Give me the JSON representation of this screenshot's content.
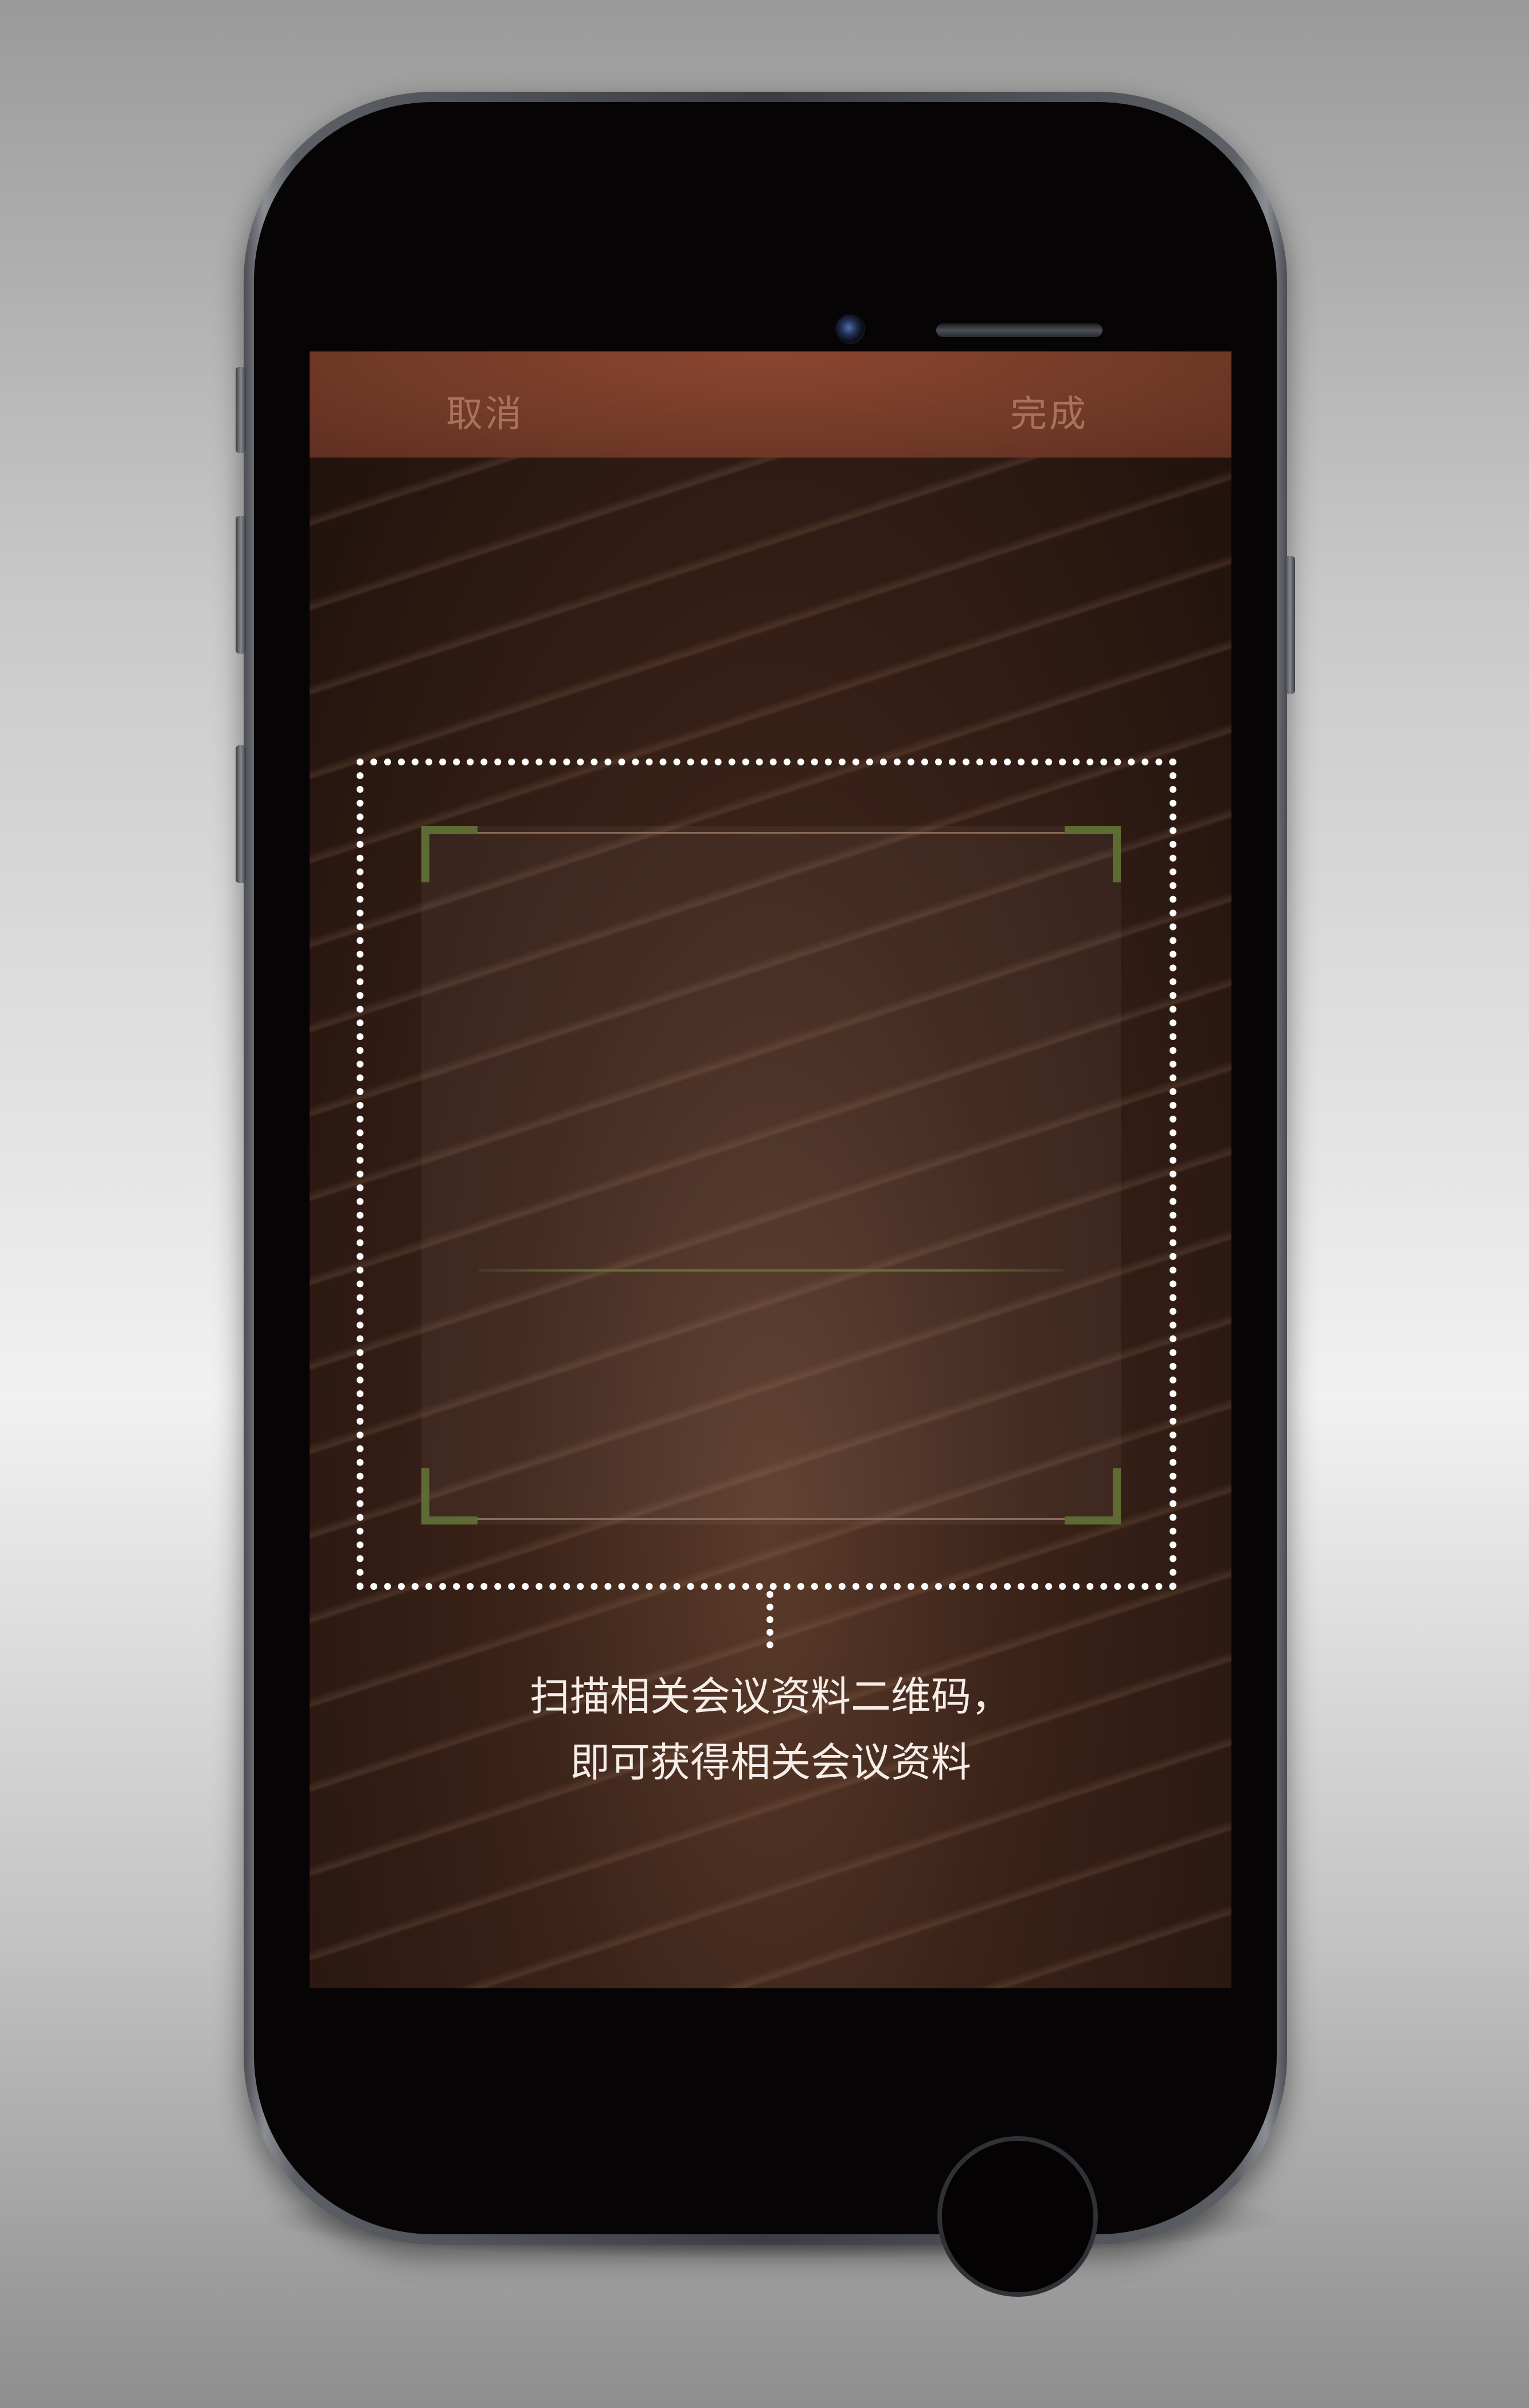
{
  "navbar": {
    "cancel_label": "取消",
    "done_label": "完成"
  },
  "scanner": {
    "hint_line_1": "扫描相关会议资料二维码，",
    "hint_line_2": "即可获得相关会议资料"
  },
  "colors": {
    "navbar_bg": "#743b29",
    "nav_text": "#a9725e",
    "scan_corner": "#5e6b33",
    "dashed_border": "#ffffff",
    "hint_text": "#f5ede8"
  },
  "icons": {
    "camera": "front-camera-icon",
    "speaker": "earpiece-speaker-icon",
    "home": "home-button-icon"
  }
}
